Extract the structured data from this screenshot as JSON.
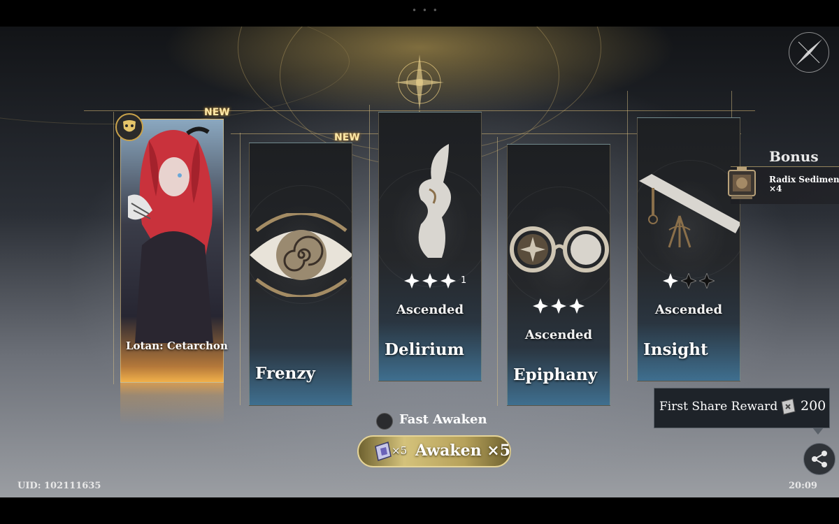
{
  "top": {
    "drag_handle": "• • •"
  },
  "cards": [
    {
      "id": "lotan",
      "name": "Lotan: Cetarchon",
      "new_label": "NEW",
      "icon": "character-portrait"
    },
    {
      "id": "frenzy",
      "name": "Frenzy",
      "new_label": "NEW",
      "icon": "eye-spiral-icon"
    },
    {
      "id": "delirium",
      "name": "Delirium",
      "status": "Ascended",
      "stars_filled": 3,
      "stars_total": 3,
      "star_count": "1",
      "icon": "seahorse-figure-icon"
    },
    {
      "id": "epiphany",
      "name": "Epiphany",
      "status": "Ascended",
      "stars_filled": 3,
      "stars_total": 3,
      "icon": "spectacles-icon"
    },
    {
      "id": "insight",
      "name": "Insight",
      "status": "Ascended",
      "stars_filled": 1,
      "stars_total": 3,
      "icon": "telescope-icon"
    }
  ],
  "bonus": {
    "title": "Bonus",
    "item_name": "Radix Sediment",
    "item_qty": "×4",
    "icon": "radix-sediment-icon"
  },
  "share": {
    "label": "First Share Reward",
    "value": "200",
    "icon": "share-icon"
  },
  "fast_awaken": {
    "label": "Fast Awaken",
    "enabled": false
  },
  "awaken": {
    "cost": "×5",
    "label": "Awaken ×5",
    "icon": "ticket-icon"
  },
  "footer": {
    "uid": "UID: 102111635",
    "time": "20:09"
  },
  "colors": {
    "gold": "#d4c27b",
    "card_blue": "#3f6f8f",
    "orange_glow": "#f2b14a"
  }
}
